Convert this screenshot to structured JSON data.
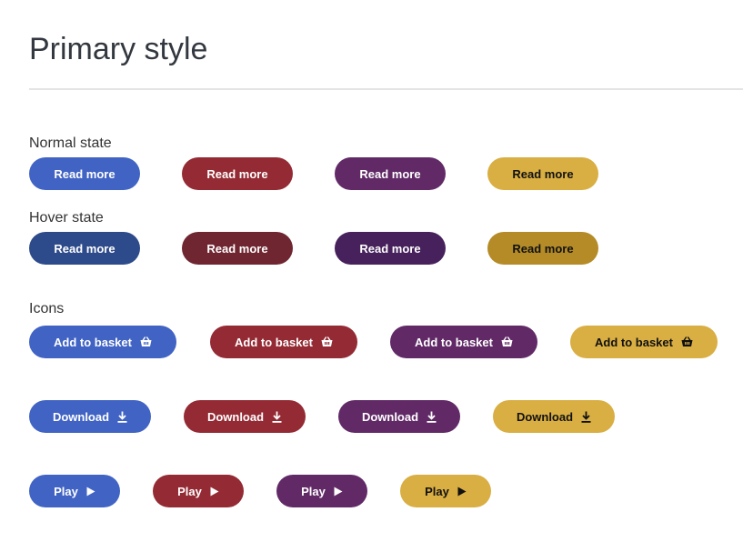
{
  "page": {
    "title": "Primary style"
  },
  "sections": {
    "normal": "Normal state",
    "hover": "Hover state",
    "icons": "Icons"
  },
  "buttons": {
    "read_more": "Read more",
    "add_to_basket": "Add to basket",
    "download": "Download",
    "play": "Play"
  },
  "icons": {
    "basket": "basket-icon",
    "download": "download-icon",
    "play": "play-icon"
  },
  "colors": {
    "blue": "#4063c4",
    "red": "#942a33",
    "purple": "#612a67",
    "yellow": "#d9ae42",
    "blue_hover": "#2d4a8a",
    "red_hover": "#6f2630",
    "purple_hover": "#46215c",
    "yellow_hover": "#b48b26"
  }
}
